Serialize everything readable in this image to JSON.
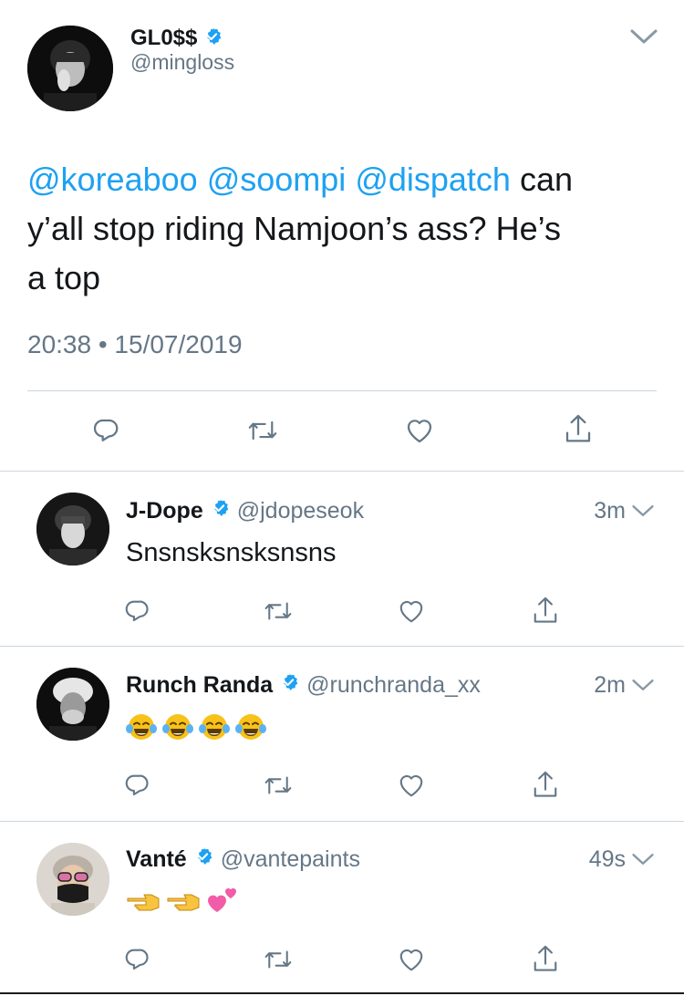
{
  "main_tweet": {
    "display_name": "GL0$$",
    "handle": "@mingloss",
    "mentions": [
      "@koreaboo",
      "@soompi",
      "@dispatch"
    ],
    "text_line1_rest": "can",
    "text_line2": "y’all stop riding Namjoon’s ass? He’s",
    "text_line3": "a top",
    "timestamp": "20:38 • 15/07/2019"
  },
  "replies": [
    {
      "display_name": "J-Dope",
      "handle": "@jdopeseok",
      "time": "3m",
      "text": "Snsnsksnsksnsns"
    },
    {
      "display_name": "Runch Randa",
      "handle": "@runchranda_xx",
      "time": "2m",
      "emojis": [
        "face-with-tears-of-joy",
        "face-with-tears-of-joy",
        "face-with-tears-of-joy",
        "face-with-tears-of-joy"
      ]
    },
    {
      "display_name": "Vanté",
      "handle": "@vantepaints",
      "time": "49s",
      "emojis": [
        "backhand-index-pointing-left",
        "backhand-index-pointing-left",
        "two-hearts"
      ]
    }
  ],
  "icons": [
    "reply-icon",
    "retweet-icon",
    "like-icon",
    "share-icon",
    "verified-badge-icon",
    "chevron-down-icon"
  ],
  "colors": {
    "accent": "#1da1f2",
    "text": "#14171a",
    "muted": "#657786",
    "divider": "#ccd6dd"
  }
}
